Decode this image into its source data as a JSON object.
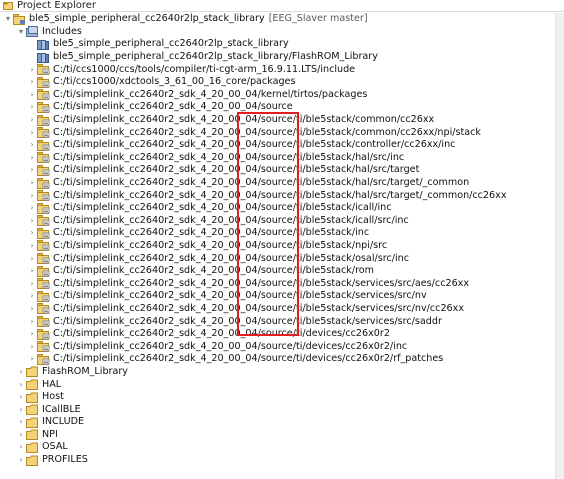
{
  "view": {
    "title": "Project Explorer",
    "project": {
      "name": "ble5_simple_peripheral_cc2640r2lp_stack_library",
      "decoration": "[EEG_Slaver master]"
    },
    "includes_label": "Includes",
    "library_entries": [
      "ble5_simple_peripheral_cc2640r2lp_stack_library",
      "ble5_simple_peripheral_cc2640r2lp_stack_library/FlashROM_Library"
    ],
    "include_paths": [
      "C:/ti/ccs1000/ccs/tools/compiler/ti-cgt-arm_16.9.11.LTS/include",
      "C:/ti/ccs1000/xdctools_3_61_00_16_core/packages",
      "C:/ti/simplelink_cc2640r2_sdk_4_20_00_04/kernel/tirtos/packages",
      "C:/ti/simplelink_cc2640r2_sdk_4_20_00_04/source",
      "C:/ti/simplelink_cc2640r2_sdk_4_20_00_04/source/ti/ble5stack/common/cc26xx",
      "C:/ti/simplelink_cc2640r2_sdk_4_20_00_04/source/ti/ble5stack/common/cc26xx/npi/stack",
      "C:/ti/simplelink_cc2640r2_sdk_4_20_00_04/source/ti/ble5stack/controller/cc26xx/inc",
      "C:/ti/simplelink_cc2640r2_sdk_4_20_00_04/source/ti/ble5stack/hal/src/inc",
      "C:/ti/simplelink_cc2640r2_sdk_4_20_00_04/source/ti/ble5stack/hal/src/target",
      "C:/ti/simplelink_cc2640r2_sdk_4_20_00_04/source/ti/ble5stack/hal/src/target/_common",
      "C:/ti/simplelink_cc2640r2_sdk_4_20_00_04/source/ti/ble5stack/hal/src/target/_common/cc26xx",
      "C:/ti/simplelink_cc2640r2_sdk_4_20_00_04/source/ti/ble5stack/icall/inc",
      "C:/ti/simplelink_cc2640r2_sdk_4_20_00_04/source/ti/ble5stack/icall/src/inc",
      "C:/ti/simplelink_cc2640r2_sdk_4_20_00_04/source/ti/ble5stack/inc",
      "C:/ti/simplelink_cc2640r2_sdk_4_20_00_04/source/ti/ble5stack/npi/src",
      "C:/ti/simplelink_cc2640r2_sdk_4_20_00_04/source/ti/ble5stack/osal/src/inc",
      "C:/ti/simplelink_cc2640r2_sdk_4_20_00_04/source/ti/ble5stack/rom",
      "C:/ti/simplelink_cc2640r2_sdk_4_20_00_04/source/ti/ble5stack/services/src/aes/cc26xx",
      "C:/ti/simplelink_cc2640r2_sdk_4_20_00_04/source/ti/ble5stack/services/src/nv",
      "C:/ti/simplelink_cc2640r2_sdk_4_20_00_04/source/ti/ble5stack/services/src/nv/cc26xx",
      "C:/ti/simplelink_cc2640r2_sdk_4_20_00_04/source/ti/ble5stack/services/src/saddr",
      "C:/ti/simplelink_cc2640r2_sdk_4_20_00_04/source/ti/devices/cc26x0r2",
      "C:/ti/simplelink_cc2640r2_sdk_4_20_00_04/source/ti/devices/cc26x0r2/inc",
      "C:/ti/simplelink_cc2640r2_sdk_4_20_00_04/source/ti/devices/cc26x0r2/rf_patches"
    ],
    "folders": [
      "FlashROM_Library",
      "HAL",
      "Host",
      "ICallBLE",
      "INCLUDE",
      "NPI",
      "OSAL",
      "PROFILES"
    ]
  },
  "colors": {
    "highlight": "#e02020",
    "folder": "#e8b84a",
    "library": "#5b7fb5"
  }
}
